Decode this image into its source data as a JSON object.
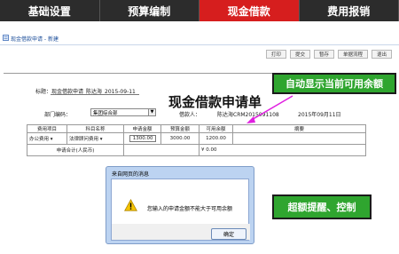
{
  "nav": {
    "tabs": [
      "基础设置",
      "预算编制",
      "现金借款",
      "费用报销"
    ],
    "active_index": 2
  },
  "breadcrumb": "现金借款申请 - 新建",
  "toolbar": [
    "打印",
    "提交",
    "暂存",
    "单据流程",
    "退出"
  ],
  "form": {
    "title_label": "标题：",
    "title_value": "现金借款申请_陈达海_2015-09-11",
    "heading": "现金借款申请单",
    "dept_label": "部门编码：",
    "dept_value": "集团综合部",
    "borrower_label": "借款人：",
    "borrower_value": "陈达海CRM2015091108",
    "date_value": "2015年09月11日"
  },
  "table": {
    "headers": [
      "费用项目",
      "科目名称",
      "申请金额",
      "预算金额",
      "可用余额",
      "摘要"
    ],
    "row": [
      "办公费用",
      "法律顾问费用",
      "1300.00",
      "3000.00",
      "1200.00",
      ""
    ],
    "total_label": "申请合计(人民币)",
    "total_value": "¥ 0.00"
  },
  "callouts": {
    "top": "自动显示当前可用余额",
    "bottom": "超额提醒、控制"
  },
  "dialog": {
    "title": "来自网页的消息",
    "message": "您输入的申请金额不能大于可用余额",
    "ok": "确定"
  },
  "colors": {
    "nav_bg": "#2c2c2c",
    "nav_active": "#d61e1e",
    "callout": "#2fa52f",
    "arrow": "#e020e0"
  }
}
